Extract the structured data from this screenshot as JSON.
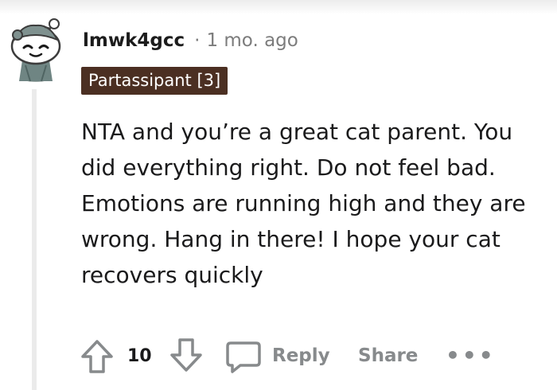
{
  "comment": {
    "author": "lmwk4gcc",
    "separator": "·",
    "timestamp": "1 mo. ago",
    "flair": "Partassipant [3]",
    "body": "NTA and you’re a great cat parent. You did everything right. Do not feel bad. Emotions are running high and they are wrong. Hang in there! I hope your cat recovers quickly",
    "score": "10",
    "reply_label": "Reply",
    "share_label": "Share",
    "more_label": "•••"
  },
  "colors": {
    "flair_background": "#4b2f22",
    "muted_text": "#878a8c",
    "thread_line": "#ebebeb"
  },
  "icons": {
    "upvote": "upvote-arrow-icon",
    "downvote": "downvote-arrow-icon",
    "reply": "speech-bubble-icon",
    "more": "more-options-icon"
  }
}
